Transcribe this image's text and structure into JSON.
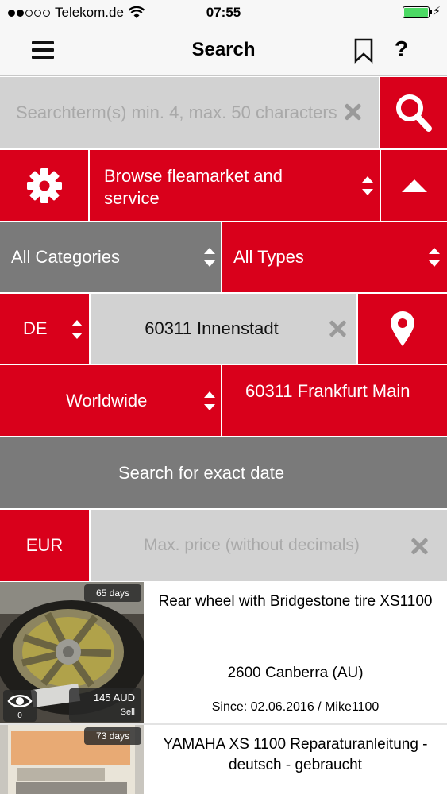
{
  "status_bar": {
    "carrier": "Telekom.de",
    "time": "07:55",
    "signal_dots": [
      true,
      true,
      false,
      false,
      false
    ]
  },
  "navbar": {
    "title": "Search",
    "icons": [
      "menu-icon",
      "bookmark-icon",
      "help-icon"
    ],
    "help_label": "?"
  },
  "search": {
    "placeholder": "Searchterm(s) min. 4, max. 50 characters"
  },
  "browse": {
    "label": "Browse fleamarket and service"
  },
  "filters": {
    "category": "All Categories",
    "type": "All Types",
    "country": "DE",
    "location": "60311 Innenstadt",
    "range": "Worldwide",
    "city": "60311 Frankfurt Main",
    "exact_date": "Search for exact date",
    "currency": "EUR",
    "price_placeholder": "Max. price (without decimals)"
  },
  "listings": [
    {
      "title": "Rear wheel with Bridgestone tire XS1100",
      "location": "2600 Canberra (AU)",
      "since": "Since: 02.06.2016 / Mike1100",
      "age": "65 days",
      "price": "145 AUD",
      "kind": "Sell",
      "views": "0"
    },
    {
      "title": "YAMAHA XS 1100 Reparaturanleitung - deutsch - gebraucht",
      "age": "73 days"
    }
  ],
  "colors": {
    "accent_red": "#d9001b",
    "grey": "#7a7a7a",
    "light_grey": "#d2d2d2"
  }
}
